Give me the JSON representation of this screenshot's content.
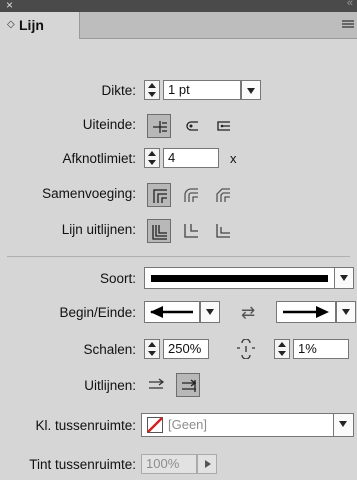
{
  "panel": {
    "close_glyph": "×",
    "collapse_glyph": "«"
  },
  "tab": {
    "arrow": "◇",
    "title": "Lijn"
  },
  "dikte": {
    "label": "Dikte:",
    "value": "1 pt"
  },
  "uiteinde": {
    "label": "Uiteinde:"
  },
  "afknot": {
    "label": "Afknotlimiet:",
    "value": "4",
    "unit": "x"
  },
  "samenvoeging": {
    "label": "Samenvoeging:"
  },
  "uitlijnen_lijn": {
    "label": "Lijn uitlijnen:"
  },
  "soort": {
    "label": "Soort:"
  },
  "begin_einde": {
    "label": "Begin/Einde:",
    "swap_glyph": "⇄"
  },
  "schalen": {
    "label": "Schalen:",
    "value_begin": "250%",
    "value_end": "1%"
  },
  "uitlijnen": {
    "label": "Uitlijnen:"
  },
  "kl_tussenruimte": {
    "label": "Kl. tussenruimte:",
    "value": "[Geen]"
  },
  "tint_tussenruimte": {
    "label": "Tint tussenruimte:",
    "value": "100%"
  },
  "colors": {
    "panel": "#d6d6d6",
    "header": "#4a4a4a",
    "selected": "#b8b8b8",
    "none_swatch": "#d32020"
  }
}
